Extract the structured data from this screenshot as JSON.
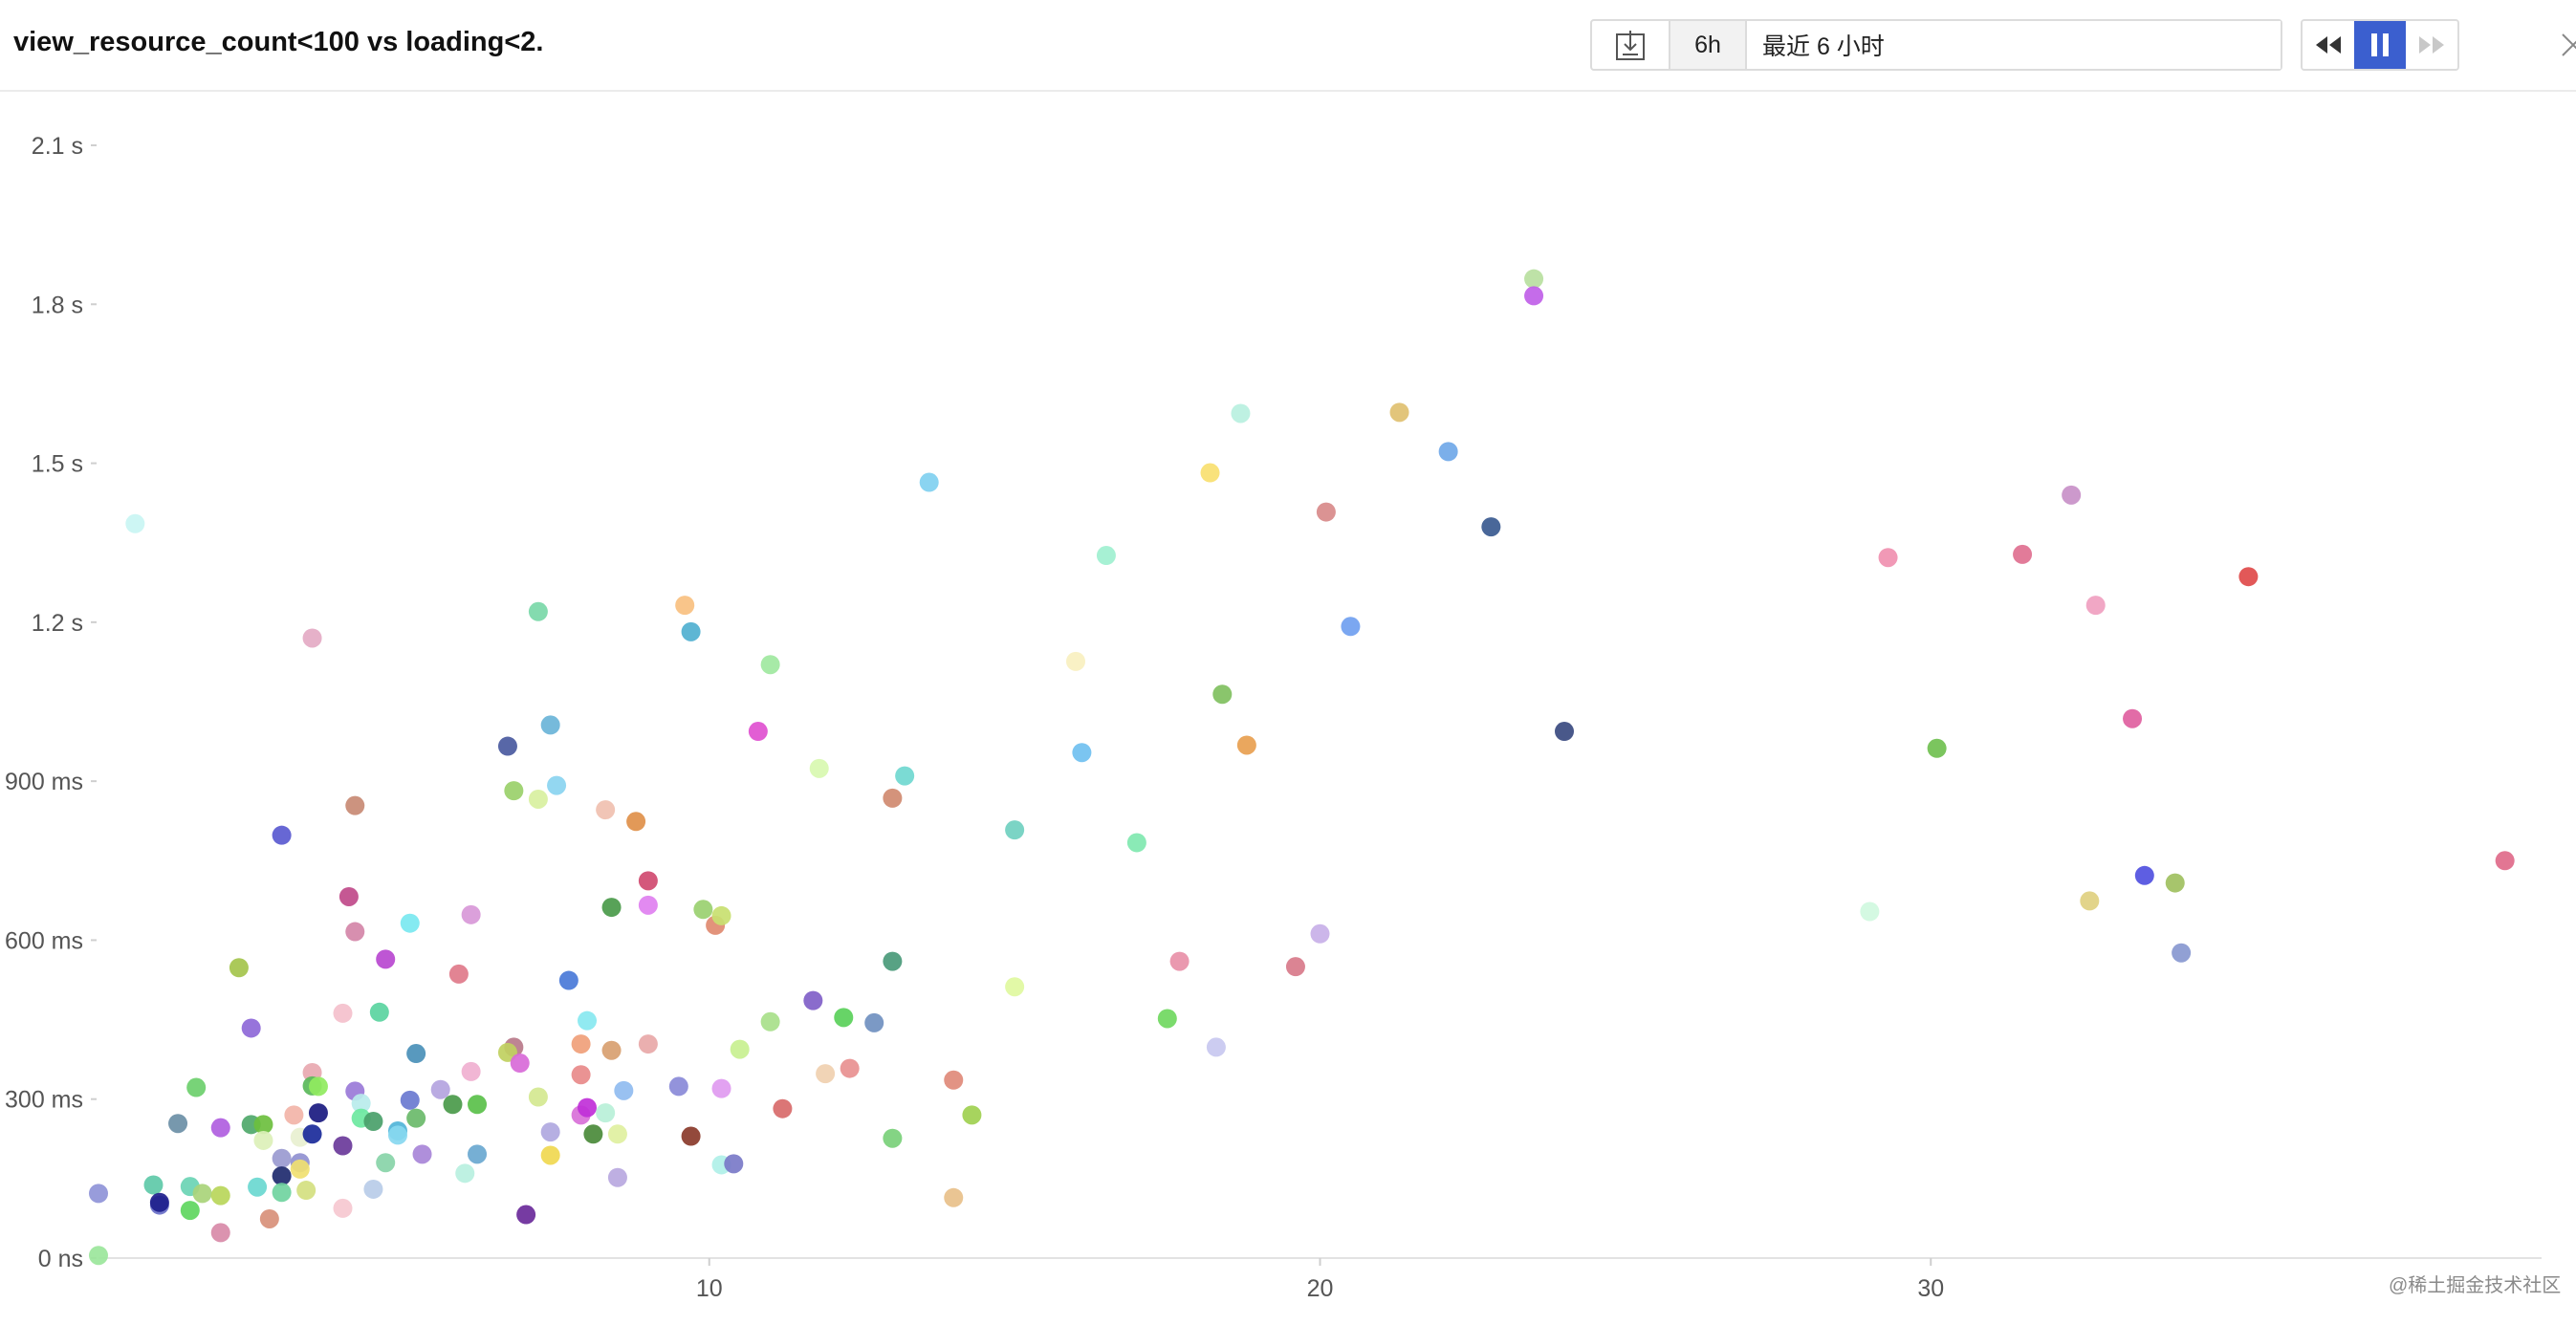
{
  "header": {
    "title": "view_resource_count<100 vs loading<2.",
    "period_label": "6h",
    "range_value": "最近 6 小时"
  },
  "icons": {
    "download": "download-icon",
    "rewind": "rewind-icon",
    "pause": "pause-icon",
    "forward": "fast-forward-icon",
    "close": "close-icon"
  },
  "colors": {
    "accent": "#3b5fcf"
  },
  "watermark": "@稀土掘金技术社区",
  "chart_data": {
    "type": "scatter",
    "title": "",
    "xlabel": "",
    "ylabel": "",
    "xlim": [
      0,
      40
    ],
    "ylim": [
      0,
      2.1
    ],
    "x_ticks": [
      10,
      20,
      30
    ],
    "x_tick_labels": [
      "10",
      "20",
      "30"
    ],
    "y_ticks": [
      0,
      0.3,
      0.6,
      0.9,
      1.2,
      1.5,
      1.8,
      2.1
    ],
    "y_tick_labels": [
      "0 ns",
      "300 ms",
      "600 ms",
      "900 ms",
      "1.2 s",
      "1.5 s",
      "1.8 s",
      "2.1 s"
    ],
    "grid": false,
    "legend": "none",
    "points": [
      {
        "x": 0.0,
        "y": 0.005,
        "color": "#9be69b"
      },
      {
        "x": 0.0,
        "y": 0.122,
        "color": "#8f94d8"
      },
      {
        "x": 0.6,
        "y": 1.386,
        "color": "#c9f5f3"
      },
      {
        "x": 0.9,
        "y": 0.138,
        "color": "#5ec9a8"
      },
      {
        "x": 1.0,
        "y": 0.1,
        "color": "#6a70c8"
      },
      {
        "x": 1.0,
        "y": 0.105,
        "color": "#1e1e8c"
      },
      {
        "x": 1.3,
        "y": 0.254,
        "color": "#6b8fa6"
      },
      {
        "x": 1.5,
        "y": 0.09,
        "color": "#5ed65e"
      },
      {
        "x": 1.5,
        "y": 0.135,
        "color": "#6ad4b4"
      },
      {
        "x": 1.6,
        "y": 0.322,
        "color": "#6ccf6c"
      },
      {
        "x": 1.7,
        "y": 0.122,
        "color": "#a9d47a"
      },
      {
        "x": 2.0,
        "y": 0.048,
        "color": "#d88aa8"
      },
      {
        "x": 2.0,
        "y": 0.118,
        "color": "#b9d65a"
      },
      {
        "x": 2.0,
        "y": 0.246,
        "color": "#b05ee0"
      },
      {
        "x": 2.3,
        "y": 0.548,
        "color": "#a4c44c"
      },
      {
        "x": 2.5,
        "y": 0.434,
        "color": "#8e68d8"
      },
      {
        "x": 2.5,
        "y": 0.252,
        "color": "#4fa86a"
      },
      {
        "x": 2.6,
        "y": 0.134,
        "color": "#6ad8d0"
      },
      {
        "x": 2.7,
        "y": 0.252,
        "color": "#6cbf3e"
      },
      {
        "x": 2.7,
        "y": 0.222,
        "color": "#dcf0b8"
      },
      {
        "x": 2.8,
        "y": 0.074,
        "color": "#d8907a"
      },
      {
        "x": 3.0,
        "y": 0.798,
        "color": "#5a5ad0"
      },
      {
        "x": 3.0,
        "y": 0.188,
        "color": "#9a9ad0"
      },
      {
        "x": 3.0,
        "y": 0.155,
        "color": "#1e2a6e"
      },
      {
        "x": 3.0,
        "y": 0.124,
        "color": "#70d4a0"
      },
      {
        "x": 3.2,
        "y": 0.27,
        "color": "#f2b4a8"
      },
      {
        "x": 3.3,
        "y": 0.18,
        "color": "#9090d0"
      },
      {
        "x": 3.3,
        "y": 0.228,
        "color": "#e8f0d0"
      },
      {
        "x": 3.3,
        "y": 0.168,
        "color": "#f0e070"
      },
      {
        "x": 3.4,
        "y": 0.128,
        "color": "#d4e080"
      },
      {
        "x": 3.5,
        "y": 1.17,
        "color": "#e4aac4"
      },
      {
        "x": 3.5,
        "y": 0.35,
        "color": "#e8a8b0"
      },
      {
        "x": 3.5,
        "y": 0.325,
        "color": "#5ab85a"
      },
      {
        "x": 3.6,
        "y": 0.324,
        "color": "#90ea60"
      },
      {
        "x": 3.6,
        "y": 0.274,
        "color": "#1a1a80"
      },
      {
        "x": 3.5,
        "y": 0.234,
        "color": "#1a2a9a"
      },
      {
        "x": 4.0,
        "y": 0.462,
        "color": "#f4c0cc"
      },
      {
        "x": 4.0,
        "y": 0.212,
        "color": "#6a3a9a"
      },
      {
        "x": 4.0,
        "y": 0.094,
        "color": "#f6c8d0"
      },
      {
        "x": 4.2,
        "y": 0.854,
        "color": "#c88a74"
      },
      {
        "x": 4.1,
        "y": 0.682,
        "color": "#c04a8a"
      },
      {
        "x": 4.2,
        "y": 0.616,
        "color": "#d486a8"
      },
      {
        "x": 4.2,
        "y": 0.315,
        "color": "#9a7ad8"
      },
      {
        "x": 4.3,
        "y": 0.292,
        "color": "#b8ecec"
      },
      {
        "x": 4.3,
        "y": 0.264,
        "color": "#6ce8a0"
      },
      {
        "x": 4.5,
        "y": 0.258,
        "color": "#4aa06a"
      },
      {
        "x": 4.5,
        "y": 0.13,
        "color": "#b8cce8"
      },
      {
        "x": 4.7,
        "y": 0.564,
        "color": "#b848d0"
      },
      {
        "x": 4.6,
        "y": 0.464,
        "color": "#5ad4a0"
      },
      {
        "x": 4.7,
        "y": 0.18,
        "color": "#88d4a8"
      },
      {
        "x": 4.9,
        "y": 0.24,
        "color": "#50b4d8"
      },
      {
        "x": 4.9,
        "y": 0.232,
        "color": "#88d8f0"
      },
      {
        "x": 5.1,
        "y": 0.632,
        "color": "#7ae8f0"
      },
      {
        "x": 5.2,
        "y": 0.386,
        "color": "#4a90b8"
      },
      {
        "x": 5.1,
        "y": 0.298,
        "color": "#6a7ad0"
      },
      {
        "x": 5.2,
        "y": 0.264,
        "color": "#6aba6a"
      },
      {
        "x": 5.3,
        "y": 0.196,
        "color": "#a886d8"
      },
      {
        "x": 5.6,
        "y": 0.318,
        "color": "#b4a4e0"
      },
      {
        "x": 5.9,
        "y": 0.536,
        "color": "#e07a8a"
      },
      {
        "x": 5.8,
        "y": 0.29,
        "color": "#4a9a4a"
      },
      {
        "x": 6.1,
        "y": 0.648,
        "color": "#d898d8"
      },
      {
        "x": 6.1,
        "y": 0.352,
        "color": "#f0b0d0"
      },
      {
        "x": 6.2,
        "y": 0.196,
        "color": "#6aa8d0"
      },
      {
        "x": 6.2,
        "y": 0.29,
        "color": "#5ac04a"
      },
      {
        "x": 6.0,
        "y": 0.16,
        "color": "#b8f0e0"
      },
      {
        "x": 6.7,
        "y": 0.966,
        "color": "#4a5aa0"
      },
      {
        "x": 6.8,
        "y": 0.882,
        "color": "#9ad06a"
      },
      {
        "x": 6.8,
        "y": 0.398,
        "color": "#b87a8a"
      },
      {
        "x": 6.7,
        "y": 0.388,
        "color": "#c0d060"
      },
      {
        "x": 6.9,
        "y": 0.368,
        "color": "#d86ad8"
      },
      {
        "x": 7.0,
        "y": 0.082,
        "color": "#6a2a9a"
      },
      {
        "x": 7.2,
        "y": 1.22,
        "color": "#7ad8a8"
      },
      {
        "x": 7.2,
        "y": 0.866,
        "color": "#d8f0a0"
      },
      {
        "x": 7.2,
        "y": 0.304,
        "color": "#d4e890"
      },
      {
        "x": 7.4,
        "y": 1.006,
        "color": "#6ab4d8"
      },
      {
        "x": 7.5,
        "y": 0.892,
        "color": "#8ad4f0"
      },
      {
        "x": 7.4,
        "y": 0.238,
        "color": "#b0a8e0"
      },
      {
        "x": 7.4,
        "y": 0.194,
        "color": "#f0d850"
      },
      {
        "x": 7.7,
        "y": 0.524,
        "color": "#4a7ad8"
      },
      {
        "x": 7.9,
        "y": 0.404,
        "color": "#f0a07a"
      },
      {
        "x": 7.9,
        "y": 0.346,
        "color": "#e88a8a"
      },
      {
        "x": 7.9,
        "y": 0.27,
        "color": "#d870d8"
      },
      {
        "x": 8.0,
        "y": 0.284,
        "color": "#c030d8"
      },
      {
        "x": 8.0,
        "y": 0.448,
        "color": "#88e8f0"
      },
      {
        "x": 8.1,
        "y": 0.234,
        "color": "#4a8a3a"
      },
      {
        "x": 8.3,
        "y": 0.846,
        "color": "#f0c0b0"
      },
      {
        "x": 8.4,
        "y": 0.662,
        "color": "#4a9a4a"
      },
      {
        "x": 8.4,
        "y": 0.392,
        "color": "#d8a070"
      },
      {
        "x": 8.3,
        "y": 0.274,
        "color": "#b8f0d8"
      },
      {
        "x": 8.5,
        "y": 0.234,
        "color": "#e0f0a0"
      },
      {
        "x": 8.5,
        "y": 0.152,
        "color": "#b8a8e0"
      },
      {
        "x": 8.6,
        "y": 0.316,
        "color": "#90bcf0"
      },
      {
        "x": 8.8,
        "y": 0.824,
        "color": "#e0904a"
      },
      {
        "x": 9.0,
        "y": 0.712,
        "color": "#d04a70"
      },
      {
        "x": 9.0,
        "y": 0.666,
        "color": "#e080f0"
      },
      {
        "x": 9.0,
        "y": 0.404,
        "color": "#e8a8a8"
      },
      {
        "x": 9.5,
        "y": 0.324,
        "color": "#8a8ad8"
      },
      {
        "x": 9.6,
        "y": 1.232,
        "color": "#f8c080"
      },
      {
        "x": 9.7,
        "y": 1.182,
        "color": "#50b0d0"
      },
      {
        "x": 9.7,
        "y": 0.23,
        "color": "#8a3a2a"
      },
      {
        "x": 9.9,
        "y": 0.658,
        "color": "#9ad070"
      },
      {
        "x": 10.1,
        "y": 0.628,
        "color": "#e08a70"
      },
      {
        "x": 10.2,
        "y": 0.646,
        "color": "#c8e070"
      },
      {
        "x": 10.2,
        "y": 0.32,
        "color": "#e09af0"
      },
      {
        "x": 10.2,
        "y": 0.176,
        "color": "#b0f0e8"
      },
      {
        "x": 10.4,
        "y": 0.178,
        "color": "#7a7ac8"
      },
      {
        "x": 10.5,
        "y": 0.394,
        "color": "#c8f090"
      },
      {
        "x": 10.8,
        "y": 0.994,
        "color": "#e050d0"
      },
      {
        "x": 11.0,
        "y": 1.12,
        "color": "#a0e8a0"
      },
      {
        "x": 11.0,
        "y": 0.446,
        "color": "#a8e08a"
      },
      {
        "x": 11.2,
        "y": 0.282,
        "color": "#d86a6a"
      },
      {
        "x": 11.8,
        "y": 0.924,
        "color": "#d8f8b0"
      },
      {
        "x": 11.7,
        "y": 0.486,
        "color": "#8060c8"
      },
      {
        "x": 11.9,
        "y": 0.348,
        "color": "#f0d0b0"
      },
      {
        "x": 12.2,
        "y": 0.454,
        "color": "#5ad05a"
      },
      {
        "x": 12.3,
        "y": 0.358,
        "color": "#e89090"
      },
      {
        "x": 12.7,
        "y": 0.444,
        "color": "#7090c0"
      },
      {
        "x": 13.0,
        "y": 0.868,
        "color": "#d08a70"
      },
      {
        "x": 13.0,
        "y": 0.56,
        "color": "#4a9a7a"
      },
      {
        "x": 13.0,
        "y": 0.226,
        "color": "#7ad07a"
      },
      {
        "x": 13.2,
        "y": 0.91,
        "color": "#70d8d0"
      },
      {
        "x": 13.6,
        "y": 1.464,
        "color": "#80d0f0"
      },
      {
        "x": 14.0,
        "y": 0.336,
        "color": "#e08a7a"
      },
      {
        "x": 14.0,
        "y": 0.114,
        "color": "#e8c08a"
      },
      {
        "x": 14.3,
        "y": 0.27,
        "color": "#a0d050"
      },
      {
        "x": 15.0,
        "y": 0.808,
        "color": "#70d0c0"
      },
      {
        "x": 15.0,
        "y": 0.512,
        "color": "#e0f8a0"
      },
      {
        "x": 16.0,
        "y": 1.126,
        "color": "#f8f0c0"
      },
      {
        "x": 16.1,
        "y": 0.954,
        "color": "#70c0f0"
      },
      {
        "x": 16.5,
        "y": 1.326,
        "color": "#a0f0d0"
      },
      {
        "x": 17.0,
        "y": 0.784,
        "color": "#80e8b0"
      },
      {
        "x": 17.5,
        "y": 0.452,
        "color": "#70d860"
      },
      {
        "x": 17.7,
        "y": 0.56,
        "color": "#e890a8"
      },
      {
        "x": 18.2,
        "y": 1.482,
        "color": "#f8e070"
      },
      {
        "x": 18.3,
        "y": 0.398,
        "color": "#c8c8f0"
      },
      {
        "x": 18.4,
        "y": 1.064,
        "color": "#80c060"
      },
      {
        "x": 18.7,
        "y": 1.594,
        "color": "#b8f0e0"
      },
      {
        "x": 18.8,
        "y": 0.968,
        "color": "#e8a050"
      },
      {
        "x": 19.6,
        "y": 0.55,
        "color": "#d87a8a"
      },
      {
        "x": 20.0,
        "y": 0.612,
        "color": "#c8b0e8"
      },
      {
        "x": 20.1,
        "y": 1.408,
        "color": "#d88a8a"
      },
      {
        "x": 20.5,
        "y": 1.192,
        "color": "#70a0f0"
      },
      {
        "x": 21.3,
        "y": 1.596,
        "color": "#e0c070"
      },
      {
        "x": 22.1,
        "y": 1.522,
        "color": "#70a8e8"
      },
      {
        "x": 22.8,
        "y": 1.38,
        "color": "#3a5a90"
      },
      {
        "x": 23.5,
        "y": 1.848,
        "color": "#b8e0a0"
      },
      {
        "x": 23.5,
        "y": 1.816,
        "color": "#c060e8"
      },
      {
        "x": 24.0,
        "y": 0.994,
        "color": "#3a4a80"
      },
      {
        "x": 29.0,
        "y": 0.654,
        "color": "#d0f8e0"
      },
      {
        "x": 29.3,
        "y": 1.322,
        "color": "#f090b0"
      },
      {
        "x": 30.1,
        "y": 0.962,
        "color": "#70c050"
      },
      {
        "x": 31.5,
        "y": 1.328,
        "color": "#e07090"
      },
      {
        "x": 32.3,
        "y": 1.44,
        "color": "#c890c8"
      },
      {
        "x": 32.7,
        "y": 1.232,
        "color": "#f0a0c0"
      },
      {
        "x": 32.6,
        "y": 0.674,
        "color": "#e0d080"
      },
      {
        "x": 33.3,
        "y": 1.018,
        "color": "#e060a0"
      },
      {
        "x": 33.5,
        "y": 0.722,
        "color": "#5050e0"
      },
      {
        "x": 34.0,
        "y": 0.708,
        "color": "#a0c060"
      },
      {
        "x": 34.1,
        "y": 0.576,
        "color": "#8898d0"
      },
      {
        "x": 35.2,
        "y": 1.286,
        "color": "#e04a4a"
      },
      {
        "x": 39.4,
        "y": 0.75,
        "color": "#e06a8a"
      }
    ]
  }
}
